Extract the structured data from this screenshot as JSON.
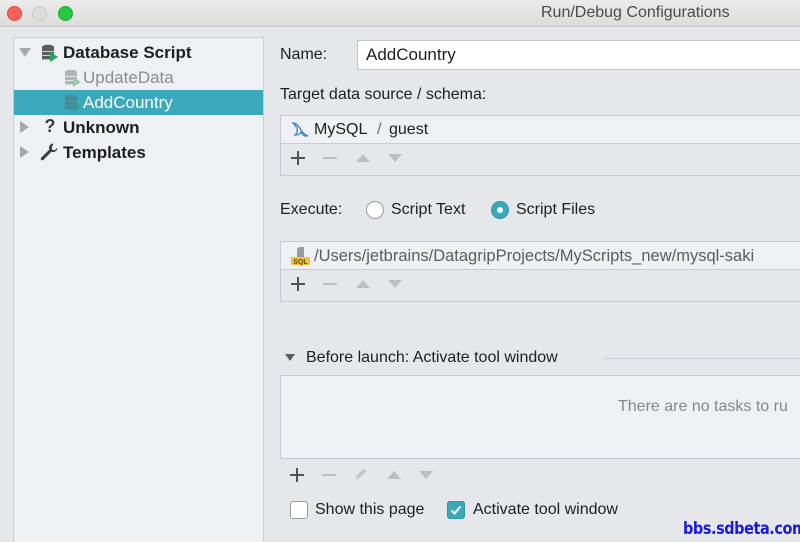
{
  "window": {
    "title": "Run/Debug Configurations",
    "traffic_lights": [
      "close",
      "minimize",
      "zoom"
    ]
  },
  "tree": {
    "groups": [
      {
        "label": "Database Script",
        "icon": "database-script-icon",
        "expanded": true,
        "children": [
          {
            "label": "UpdateData",
            "icon": "database-script-icon",
            "selected": false
          },
          {
            "label": "AddCountry",
            "icon": "database-script-icon",
            "selected": true
          }
        ]
      },
      {
        "label": "Unknown",
        "icon": "question-icon",
        "expanded": false
      },
      {
        "label": "Templates",
        "icon": "wrench-icon",
        "expanded": false
      }
    ]
  },
  "form": {
    "name_label": "Name:",
    "name_value": "AddCountry",
    "target_label": "Target data source / schema:",
    "target_items": [
      {
        "datasource": "MySQL",
        "separator": "/",
        "schema": "guest",
        "icon": "mysql-dolphin-icon"
      }
    ],
    "execute_label": "Execute:",
    "execute_options": [
      {
        "label": "Script Text",
        "checked": false
      },
      {
        "label": "Script Files",
        "checked": true
      }
    ],
    "script_files": [
      {
        "path": "/Users/jetbrains/DatagripProjects/MyScripts_new/mysql-saki",
        "icon": "sql-file-icon"
      }
    ],
    "list_toolbar": [
      "add",
      "remove",
      "move-up",
      "move-down"
    ]
  },
  "before_launch": {
    "title": "Before launch: Activate tool window",
    "empty_text": "There are no tasks to ru",
    "toolbar": [
      "add",
      "remove",
      "edit",
      "move-up",
      "move-down"
    ],
    "show_this_page": {
      "label": "Show this page",
      "checked": false
    },
    "activate_tool_window": {
      "label": "Activate tool window",
      "checked": true
    }
  },
  "colors": {
    "accent": "#3ba8bb",
    "background": "#e6e7ea",
    "tree_background": "#eef0f3",
    "watermark": "#1a1adf"
  },
  "watermark": "bbs.sdbeta.com"
}
